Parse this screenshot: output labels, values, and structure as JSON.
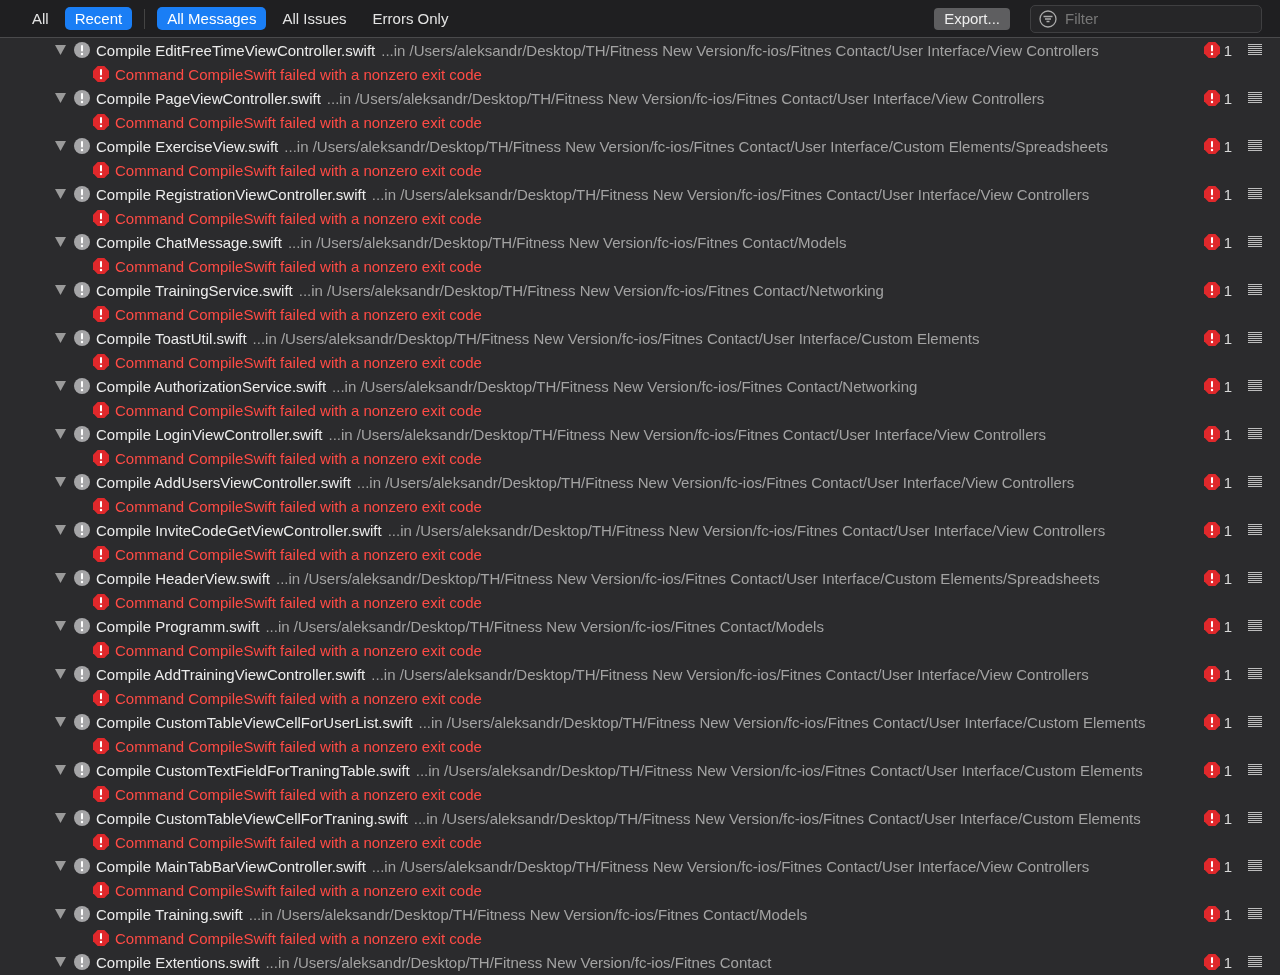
{
  "scope_tabs": [
    {
      "label": "All",
      "selected": false
    },
    {
      "label": "Recent",
      "selected": true
    }
  ],
  "filter_tabs": [
    {
      "label": "All Messages",
      "selected": true
    },
    {
      "label": "All Issues",
      "selected": false
    },
    {
      "label": "Errors Only",
      "selected": false
    }
  ],
  "export_button": "Export...",
  "filter": {
    "placeholder": "Filter"
  },
  "issues": [
    {
      "title": "Compile EditFreeTimeViewController.swift",
      "location": "...in /Users/aleksandr/Desktop/TH/Fitness New Version/fc-ios/Fitnes Contact/User Interface/View Controllers",
      "count": "1",
      "expanded": true,
      "message": "Command CompileSwift failed with a nonzero exit code"
    },
    {
      "title": "Compile PageViewController.swift",
      "location": "...in /Users/aleksandr/Desktop/TH/Fitness New Version/fc-ios/Fitnes Contact/User Interface/View Controllers",
      "count": "1",
      "expanded": true,
      "message": "Command CompileSwift failed with a nonzero exit code"
    },
    {
      "title": "Compile ExerciseView.swift",
      "location": "...in /Users/aleksandr/Desktop/TH/Fitness New Version/fc-ios/Fitnes Contact/User Interface/Custom Elements/Spreadsheets",
      "count": "1",
      "expanded": true,
      "message": "Command CompileSwift failed with a nonzero exit code"
    },
    {
      "title": "Compile RegistrationViewController.swift",
      "location": "...in /Users/aleksandr/Desktop/TH/Fitness New Version/fc-ios/Fitnes Contact/User Interface/View Controllers",
      "count": "1",
      "expanded": true,
      "message": "Command CompileSwift failed with a nonzero exit code"
    },
    {
      "title": "Compile ChatMessage.swift",
      "location": "...in /Users/aleksandr/Desktop/TH/Fitness New Version/fc-ios/Fitnes Contact/Models",
      "count": "1",
      "expanded": true,
      "message": "Command CompileSwift failed with a nonzero exit code"
    },
    {
      "title": "Compile TrainingService.swift",
      "location": "...in /Users/aleksandr/Desktop/TH/Fitness New Version/fc-ios/Fitnes Contact/Networking",
      "count": "1",
      "expanded": true,
      "message": "Command CompileSwift failed with a nonzero exit code"
    },
    {
      "title": "Compile ToastUtil.swift",
      "location": "...in /Users/aleksandr/Desktop/TH/Fitness New Version/fc-ios/Fitnes Contact/User Interface/Custom Elements",
      "count": "1",
      "expanded": true,
      "message": "Command CompileSwift failed with a nonzero exit code"
    },
    {
      "title": "Compile AuthorizationService.swift",
      "location": "...in /Users/aleksandr/Desktop/TH/Fitness New Version/fc-ios/Fitnes Contact/Networking",
      "count": "1",
      "expanded": true,
      "message": "Command CompileSwift failed with a nonzero exit code"
    },
    {
      "title": "Compile LoginViewController.swift",
      "location": "...in /Users/aleksandr/Desktop/TH/Fitness New Version/fc-ios/Fitnes Contact/User Interface/View Controllers",
      "count": "1",
      "expanded": true,
      "message": "Command CompileSwift failed with a nonzero exit code"
    },
    {
      "title": "Compile AddUsersViewController.swift",
      "location": "...in /Users/aleksandr/Desktop/TH/Fitness New Version/fc-ios/Fitnes Contact/User Interface/View Controllers",
      "count": "1",
      "expanded": true,
      "message": "Command CompileSwift failed with a nonzero exit code"
    },
    {
      "title": "Compile InviteCodeGetViewController.swift",
      "location": "...in /Users/aleksandr/Desktop/TH/Fitness New Version/fc-ios/Fitnes Contact/User Interface/View Controllers",
      "count": "1",
      "expanded": true,
      "message": "Command CompileSwift failed with a nonzero exit code"
    },
    {
      "title": "Compile HeaderView.swift",
      "location": "...in /Users/aleksandr/Desktop/TH/Fitness New Version/fc-ios/Fitnes Contact/User Interface/Custom Elements/Spreadsheets",
      "count": "1",
      "expanded": true,
      "message": "Command CompileSwift failed with a nonzero exit code"
    },
    {
      "title": "Compile Programm.swift",
      "location": "...in /Users/aleksandr/Desktop/TH/Fitness New Version/fc-ios/Fitnes Contact/Models",
      "count": "1",
      "expanded": true,
      "message": "Command CompileSwift failed with a nonzero exit code"
    },
    {
      "title": "Compile AddTrainingViewController.swift",
      "location": "...in /Users/aleksandr/Desktop/TH/Fitness New Version/fc-ios/Fitnes Contact/User Interface/View Controllers",
      "count": "1",
      "expanded": true,
      "message": "Command CompileSwift failed with a nonzero exit code"
    },
    {
      "title": "Compile CustomTableViewCellForUserList.swift",
      "location": "...in /Users/aleksandr/Desktop/TH/Fitness New Version/fc-ios/Fitnes Contact/User Interface/Custom Elements",
      "count": "1",
      "expanded": true,
      "message": "Command CompileSwift failed with a nonzero exit code"
    },
    {
      "title": "Compile CustomTextFieldForTraningTable.swift",
      "location": "...in /Users/aleksandr/Desktop/TH/Fitness New Version/fc-ios/Fitnes Contact/User Interface/Custom Elements",
      "count": "1",
      "expanded": true,
      "message": "Command CompileSwift failed with a nonzero exit code"
    },
    {
      "title": "Compile CustomTableViewCellForTraning.swift",
      "location": "...in /Users/aleksandr/Desktop/TH/Fitness New Version/fc-ios/Fitnes Contact/User Interface/Custom Elements",
      "count": "1",
      "expanded": true,
      "message": "Command CompileSwift failed with a nonzero exit code"
    },
    {
      "title": "Compile MainTabBarViewController.swift",
      "location": "...in /Users/aleksandr/Desktop/TH/Fitness New Version/fc-ios/Fitnes Contact/User Interface/View Controllers",
      "count": "1",
      "expanded": true,
      "message": "Command CompileSwift failed with a nonzero exit code"
    },
    {
      "title": "Compile Training.swift",
      "location": "...in /Users/aleksandr/Desktop/TH/Fitness New Version/fc-ios/Fitnes Contact/Models",
      "count": "1",
      "expanded": true,
      "message": "Command CompileSwift failed with a nonzero exit code"
    },
    {
      "title": "Compile Extentions.swift",
      "location": "...in /Users/aleksandr/Desktop/TH/Fitness New Version/fc-ios/Fitnes Contact",
      "count": "1",
      "expanded": true
    }
  ]
}
